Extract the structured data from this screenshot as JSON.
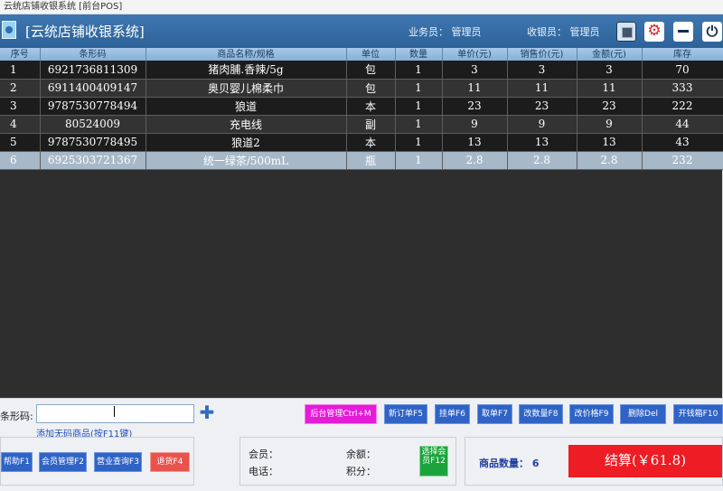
{
  "window": {
    "title": "云统店铺收银系统 [前台POS]"
  },
  "header": {
    "app_title": "[云统店铺收银系统]",
    "salesman": "业务员： 管理员",
    "cashier": "收银员： 管理员",
    "buttons": {
      "screen_icon": "screen-icon",
      "settings_icon": "gear-icon",
      "minimize_icon": "minimize-icon",
      "power_icon": "power-icon",
      "settings_symbol": "⚙",
      "power_symbol": "⏻"
    }
  },
  "grid": {
    "columns": [
      "序号",
      "条形码",
      "商品名称/规格",
      "单位",
      "数量",
      "单价(元)",
      "销售价(元)",
      "金额(元)",
      "库存"
    ],
    "rows": [
      [
        "1",
        "6921736811309",
        "猪肉脯.香辣/5g",
        "包",
        "1",
        "3",
        "3",
        "3",
        "70"
      ],
      [
        "2",
        "6911400409147",
        "奥贝婴儿棉柔巾",
        "包",
        "1",
        "11",
        "11",
        "11",
        "333"
      ],
      [
        "3",
        "9787530778494",
        "狼道",
        "本",
        "1",
        "23",
        "23",
        "23",
        "222"
      ],
      [
        "4",
        "80524009",
        "充电线",
        "副",
        "1",
        "9",
        "9",
        "9",
        "44"
      ],
      [
        "5",
        "9787530778495",
        "狼道2",
        "本",
        "1",
        "13",
        "13",
        "13",
        "43"
      ],
      [
        "6",
        "6925303721367",
        "统一绿茶/500mL",
        "瓶",
        "1",
        "2.8",
        "2.8",
        "2.8",
        "232"
      ]
    ],
    "selected_row": 6
  },
  "input": {
    "barcode_label": "条形码:",
    "barcode_value": "",
    "add_icon": "plus-icon",
    "add_symbol": "✚",
    "add_unlisted_link": "添加无码商品(按F11键)"
  },
  "function_buttons": {
    "backend": "后台管理Ctrl+M",
    "new_order": "新订单F5",
    "hold": "挂单F6",
    "retrieve": "取单F7",
    "change_qty": "改数量F8",
    "change_price": "改价格F9",
    "delete": "删除Del",
    "cash_drawer": "开钱箱F10"
  },
  "left_buttons": {
    "help": "帮助F1",
    "member_mgmt": "会员管理F2",
    "sales_query": "营业查询F3",
    "return": "退货F4"
  },
  "member": {
    "member_label": "会员：",
    "phone_label": "电话：",
    "balance_label": "余额：",
    "points_label": "积分：",
    "select_member": "选择会员F12"
  },
  "payment": {
    "qty_text": "商品数量： 6",
    "settle_text": "结算(￥61.8)"
  }
}
